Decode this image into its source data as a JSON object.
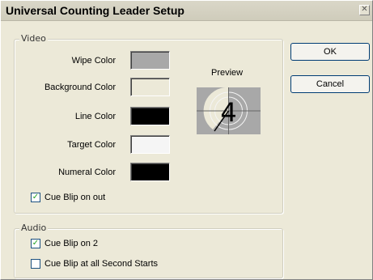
{
  "window": {
    "title": "Universal Counting Leader Setup",
    "close_glyph": "✕"
  },
  "video": {
    "group_label": "Video",
    "colors": [
      {
        "label": "Wipe Color",
        "color": "#a8a8a8"
      },
      {
        "label": "Background Color",
        "color": "#ece9d8"
      },
      {
        "label": "Line Color",
        "color": "#000000"
      },
      {
        "label": "Target Color",
        "color": "#f5f5f5"
      },
      {
        "label": "Numeral Color",
        "color": "#000000"
      }
    ],
    "cue_blip_on_out": {
      "label": "Cue Blip on out",
      "checked": true
    },
    "preview": {
      "label": "Preview",
      "numeral": "4"
    }
  },
  "audio": {
    "group_label": "Audio",
    "cue_blip_on_2": {
      "label": "Cue Blip on 2",
      "checked": true
    },
    "cue_blip_all_seconds": {
      "label": "Cue Blip at all Second Starts",
      "checked": false
    }
  },
  "buttons": {
    "ok_label": "OK",
    "cancel_label": "Cancel"
  },
  "icons": {
    "checkmark": "✓"
  }
}
